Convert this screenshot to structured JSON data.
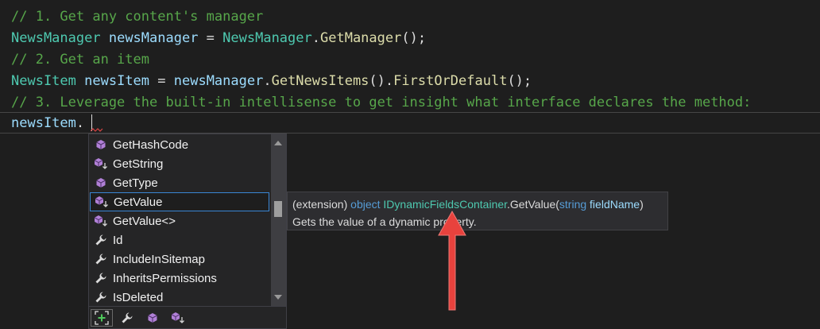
{
  "editor": {
    "lines": [
      {
        "kind": "comment",
        "text": "// 1. Get any content's manager"
      },
      {
        "kind": "stmt1",
        "type": "NewsManager",
        "var": "newsManager",
        "eq": " = ",
        "recv": "NewsManager",
        "dot": ".",
        "method": "GetManager",
        "tail": "();"
      },
      {
        "kind": "comment",
        "text": "// 2. Get an item"
      },
      {
        "kind": "stmt2",
        "type": "NewsItem",
        "var": "newsItem",
        "eq": " = ",
        "recv": "newsManager",
        "dot1": ".",
        "method1": "GetNewsItems",
        "mid": "().",
        "method2": "FirstOrDefault",
        "tail": "();"
      },
      {
        "kind": "comment",
        "text": "// 3. Leverage the built-in intellisense to get insight what interface declares the method:"
      },
      {
        "kind": "current",
        "var": "newsItem",
        "dot": "."
      }
    ]
  },
  "completion": {
    "items": [
      {
        "label": "GetHashCode",
        "icon": "method-icon"
      },
      {
        "label": "GetString",
        "icon": "extension-method-icon"
      },
      {
        "label": "GetType",
        "icon": "method-icon"
      },
      {
        "label": "GetValue",
        "icon": "extension-method-icon",
        "selected": true
      },
      {
        "label": "GetValue<>",
        "icon": "extension-method-icon"
      },
      {
        "label": "Id",
        "icon": "property-wrench-icon"
      },
      {
        "label": "IncludeInSitemap",
        "icon": "property-wrench-icon"
      },
      {
        "label": "InheritsPermissions",
        "icon": "property-wrench-icon"
      },
      {
        "label": "IsDeleted",
        "icon": "property-wrench-icon"
      }
    ],
    "filters": [
      "expand-filter-icon",
      "property-filter-icon",
      "method-filter-icon",
      "extension-method-filter-icon"
    ]
  },
  "tooltip": {
    "prefix": "(extension) ",
    "return_type": "object",
    "space1": " ",
    "interface": "IDynamicFieldsContainer",
    "member": ".GetValue(",
    "param_type": "string",
    "space2": " ",
    "param_name": "fieldName",
    "close": ")",
    "description": "Gets the value of a dynamic property."
  },
  "colors": {
    "background": "#1e1e1e",
    "comment": "#57a64a",
    "type": "#4ec9b0",
    "variable": "#9cdcfe",
    "method": "#dcdcaa",
    "keyword": "#569cd6",
    "selection_border": "#3a86d4",
    "annotation_arrow": "#e8423d"
  }
}
